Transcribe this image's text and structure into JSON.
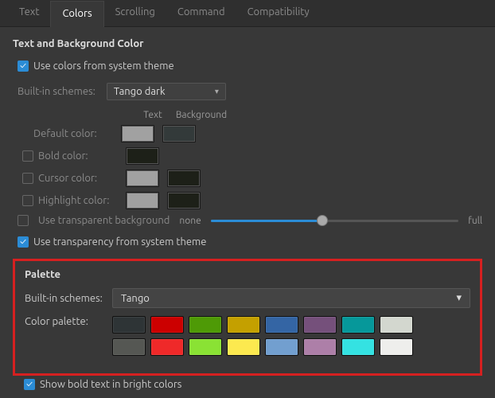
{
  "tabs": {
    "text": "Text",
    "colors": "Colors",
    "scrolling": "Scrolling",
    "command": "Command",
    "compat": "Compatibility"
  },
  "section1": {
    "title": "Text and Background Color",
    "use_system": "Use colors from system theme",
    "scheme_label": "Built-in schemes:",
    "scheme_value": "Tango dark",
    "col_text": "Text",
    "col_bg": "Background",
    "default": "Default color:",
    "bold": "Bold color:",
    "cursor": "Cursor color:",
    "highlight": "Highlight color:",
    "swatches": {
      "default_text": "#a1a1a1",
      "default_bg": "#333a3a",
      "bold_text": "#1d2018",
      "cursor_text": "#a1a1a1",
      "cursor_bg": "#1d2018",
      "highlight_text": "#a1a1a1",
      "highlight_bg": "#1d2018"
    },
    "use_transparent_bg": "Use transparent background",
    "slider_none": "none",
    "slider_full": "full",
    "slider_pct": 45,
    "use_transparency_system": "Use transparency from system theme"
  },
  "palette": {
    "title": "Palette",
    "scheme_label": "Built-in schemes:",
    "scheme_value": "Tango",
    "palette_label": "Color palette:",
    "row1": [
      "#2e3436",
      "#cc0000",
      "#4e9a06",
      "#c4a000",
      "#3465a4",
      "#75507b",
      "#06989a",
      "#d3d7cf"
    ],
    "row2": [
      "#555753",
      "#ef2929",
      "#8ae234",
      "#fce94f",
      "#729fcf",
      "#ad7fa8",
      "#34e2e2",
      "#eeeeec"
    ]
  },
  "bottom": {
    "show_bold_bright": "Show bold text in bright colors"
  }
}
